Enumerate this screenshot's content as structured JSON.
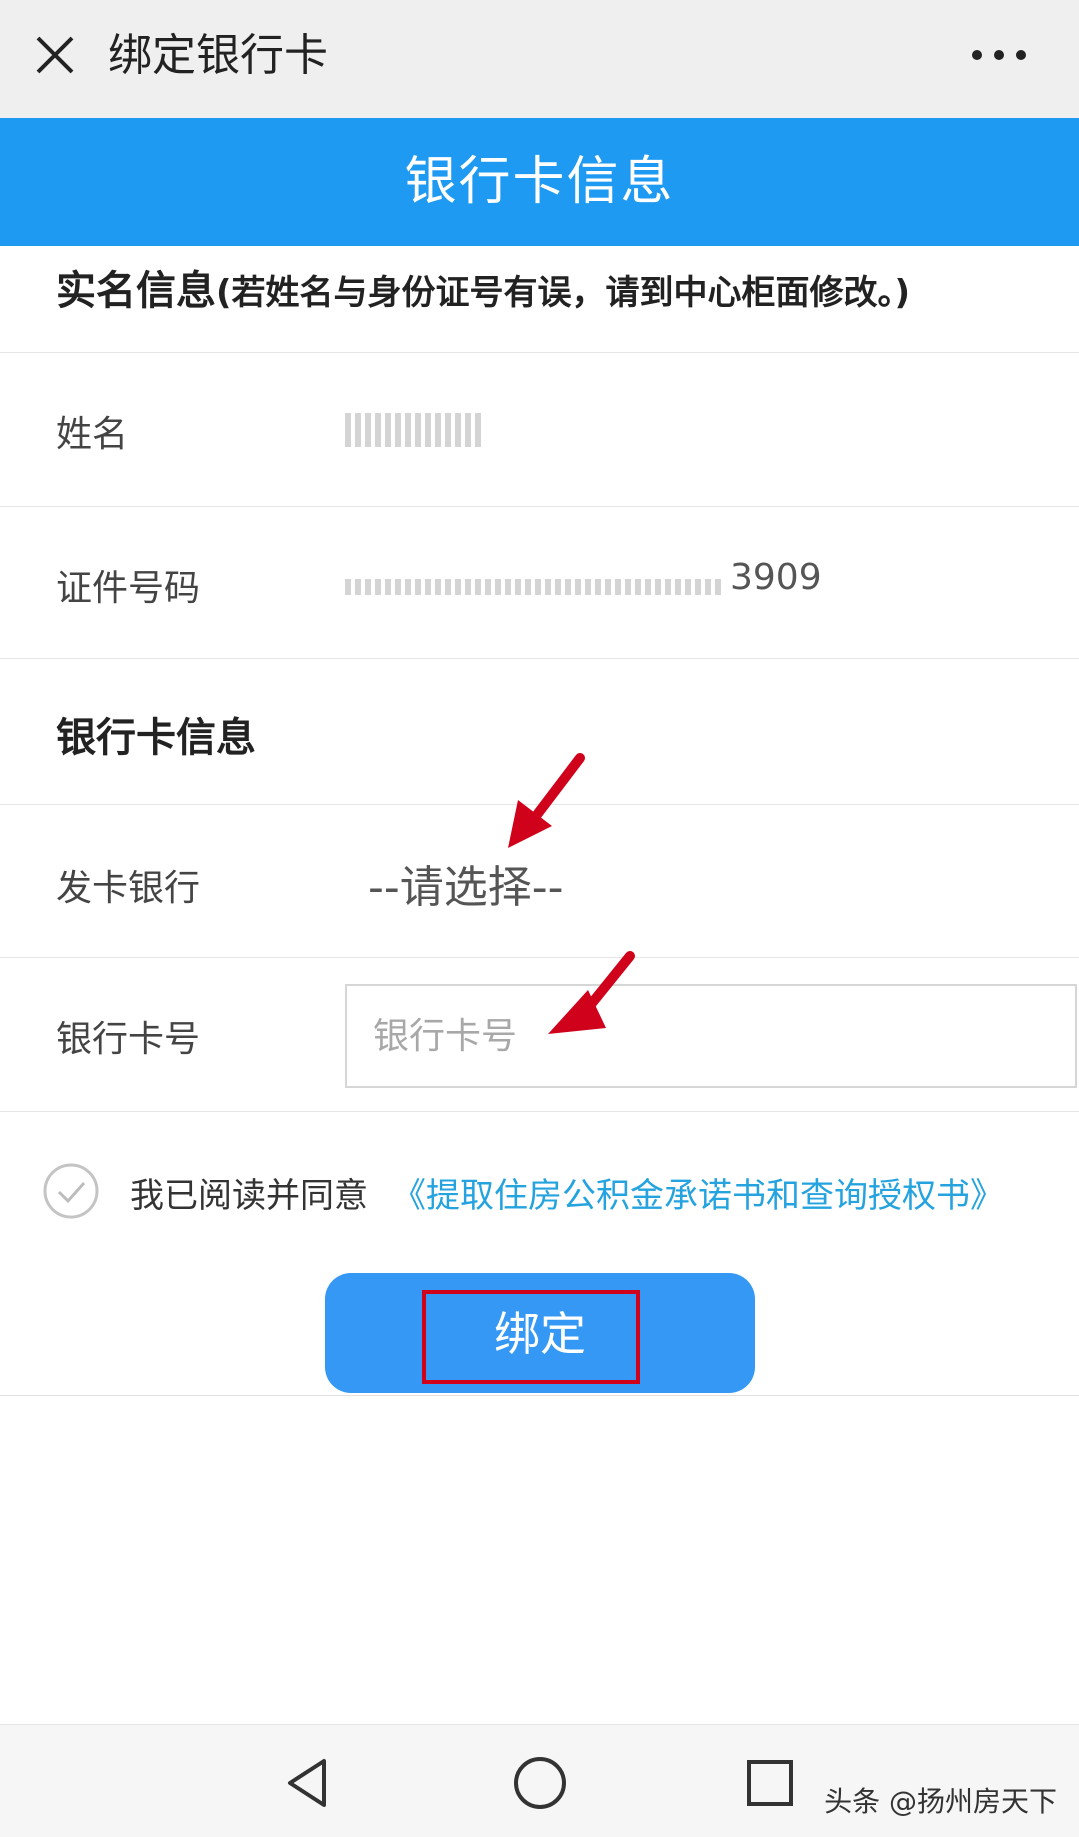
{
  "topbar": {
    "close_icon": "close-icon",
    "title": "绑定银行卡",
    "more_icon": "more-icon"
  },
  "banner": {
    "title": "银行卡信息"
  },
  "realname_section": {
    "heading": "实名信息",
    "note": "(若姓名与身份证号有误，请到中心柜面修改。)",
    "name_label": "姓名",
    "id_label": "证件号码",
    "id_value_visible": "3909"
  },
  "bank_section": {
    "heading": "银行卡信息",
    "bank_label": "发卡银行",
    "bank_select_value": "--请选择--",
    "card_label": "银行卡号",
    "card_placeholder": "银行卡号"
  },
  "agreement": {
    "check_icon": "check-circle-icon",
    "text": "我已阅读并同意",
    "link": "《提取住房公积金承诺书和查询授权书》"
  },
  "bind_button": {
    "label": "绑定"
  },
  "navbar": {
    "back_icon": "back-triangle-icon",
    "home_icon": "home-circle-icon",
    "recent_icon": "recent-square-icon"
  },
  "watermark": "头条 @扬州房天下",
  "colors": {
    "banner_blue": "#1e9af2",
    "button_blue": "#3598f5",
    "link_blue": "#24a3df",
    "annotation_red": "#d0021b"
  }
}
